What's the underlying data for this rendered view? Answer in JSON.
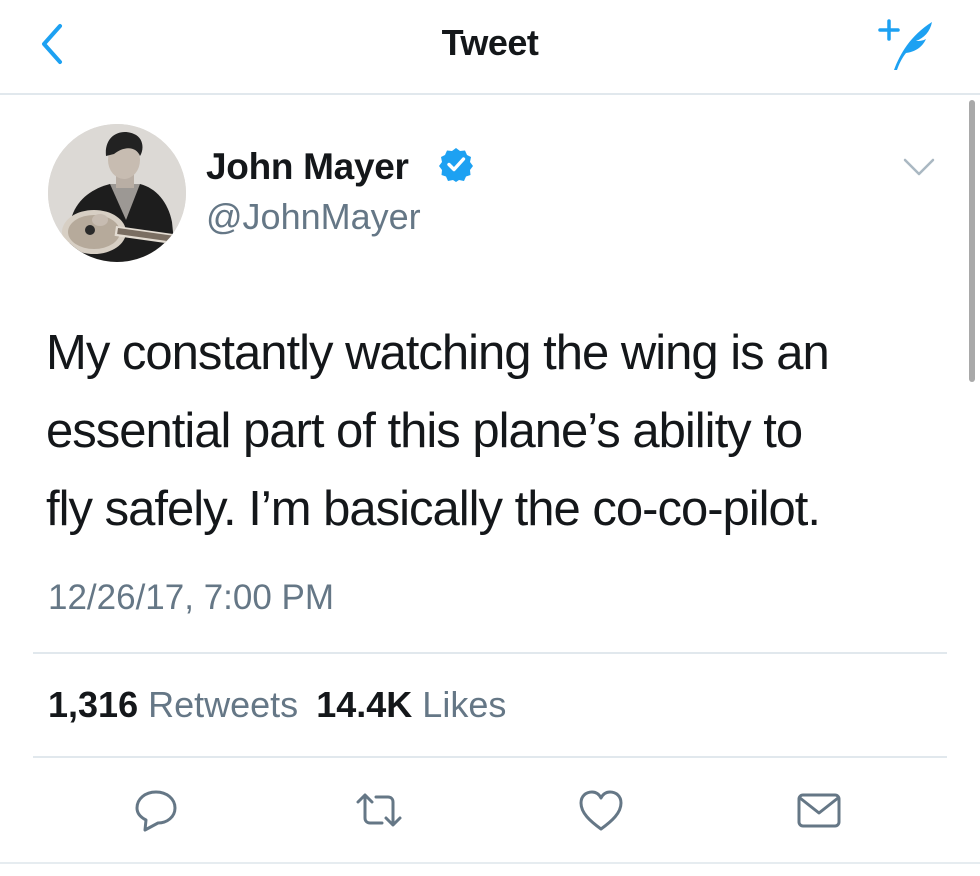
{
  "nav": {
    "title": "Tweet",
    "back_icon": "chevron-left-icon",
    "compose_icon": "compose-tweet-icon"
  },
  "tweet": {
    "author_name": "John Mayer",
    "author_handle": "@JohnMayer",
    "verified": true,
    "text_lines": [
      "My constantly watching the wing is an",
      "essential part of this plane’s ability to",
      "fly safely. I’m basically the co-co-pilot."
    ],
    "timestamp": "12/26/17, 7:00 PM",
    "retweet_count": "1,316",
    "retweet_label": "Retweets",
    "like_count": "14.4K",
    "like_label": "Likes"
  },
  "actions": [
    "reply-icon",
    "retweet-icon",
    "like-icon",
    "share-icon"
  ],
  "colors": {
    "accent": "#1da1f2",
    "text": "#14171a",
    "secondary": "#657786",
    "divider": "#e1e8ed",
    "icon": "#657786"
  }
}
